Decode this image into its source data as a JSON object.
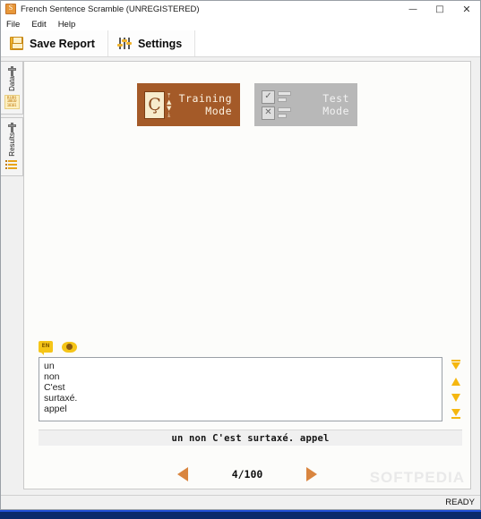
{
  "window": {
    "title": "French Sentence Scramble (UNREGISTERED)",
    "app_icon": "app-icon",
    "minimize": "—",
    "maximize": "□",
    "close": "✕"
  },
  "menu": {
    "items": [
      {
        "label": "File"
      },
      {
        "label": "Edit"
      },
      {
        "label": "Help"
      }
    ]
  },
  "toolbar": {
    "save_label": "Save Report",
    "settings_label": "Settings",
    "save_icon": "floppy-disk-icon",
    "settings_icon": "sliders-icon"
  },
  "sidebar": {
    "tabs": [
      {
        "label": "Data",
        "icon": "binary-data-icon"
      },
      {
        "label": "Results",
        "icon": "list-lines-icon"
      }
    ]
  },
  "modes": {
    "training": {
      "label": "Training\nMode",
      "icon": "c-cedilla-card-icon",
      "arrows": "↨",
      "color": "#a45a28",
      "active": true
    },
    "test": {
      "label": "Test\nMode",
      "icon": "checkbox-list-icon",
      "check": "✓",
      "cross": "✕",
      "color": "#b8b8b8",
      "active": false
    }
  },
  "word_area": {
    "language_icon": "EN",
    "language_icon_name": "en-speech-bubble-icon",
    "reveal_icon_name": "eye-icon",
    "words": [
      "un",
      "non",
      "C'est",
      "surtaxé.",
      "appel"
    ],
    "order_buttons": [
      {
        "name": "move-to-top",
        "glyph": "⤒"
      },
      {
        "name": "move-up",
        "glyph": "▲"
      },
      {
        "name": "move-down",
        "glyph": "▼"
      },
      {
        "name": "move-to-bottom",
        "glyph": "⤓"
      }
    ],
    "order_button_color": "#f5b70f"
  },
  "answer": {
    "sentence": "un non C'est surtaxé. appel"
  },
  "navigation": {
    "prev_icon": "left-triangle-icon",
    "next_icon": "right-triangle-icon",
    "counter": "4/100",
    "arrow_color": "#d9853f"
  },
  "watermark": {
    "text": "SOFTPEDIA"
  },
  "statusbar": {
    "text": "READY"
  }
}
